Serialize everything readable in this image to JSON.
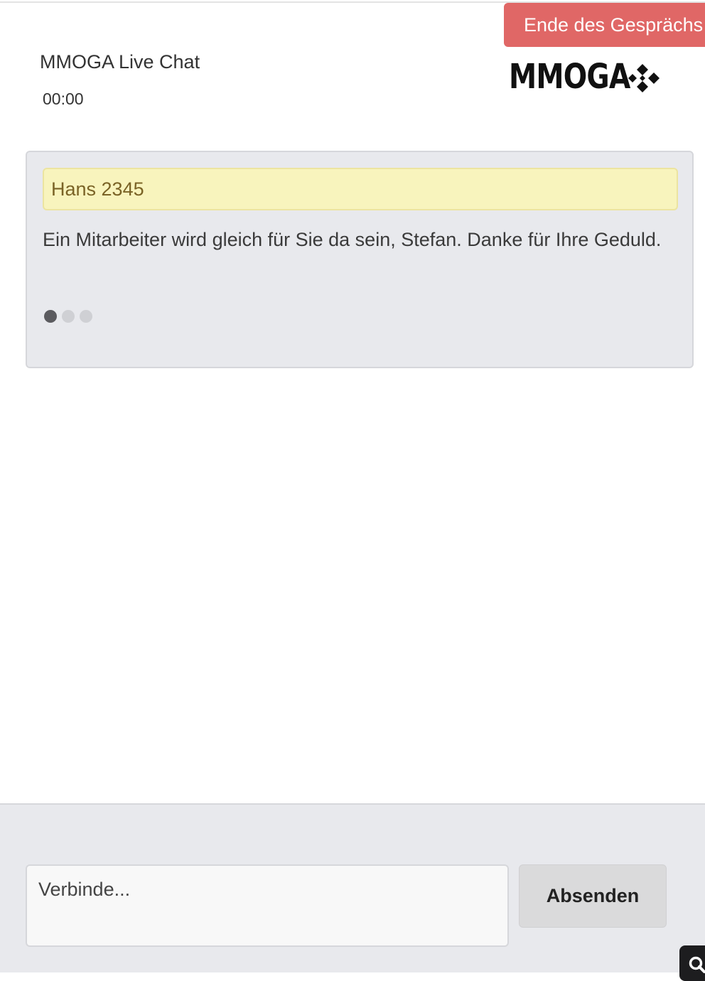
{
  "header": {
    "end_button_label": "Ende des Gesprächs",
    "title": "MMOGA Live Chat",
    "timer": "00:00",
    "logo_text": "MMOGA"
  },
  "conversation": {
    "sender_name": "Hans 2345",
    "message": "Ein Mitarbeiter wird gleich für Sie da sein, Stefan. Danke für Ihre Geduld.",
    "typing_indicator": {
      "dots": 3,
      "active_dot": 1
    }
  },
  "composer": {
    "input_placeholder": "Verbinde...",
    "send_label": "Absenden"
  },
  "icons": {
    "logo_mark": "diamond-cluster-icon",
    "corner_widget": "search-icon"
  },
  "colors": {
    "end_button": "#e06766",
    "card_background": "#e8e9ed",
    "sender_highlight": "#f8f4bd",
    "sender_text": "#7a6326",
    "send_button": "#dadadb"
  }
}
